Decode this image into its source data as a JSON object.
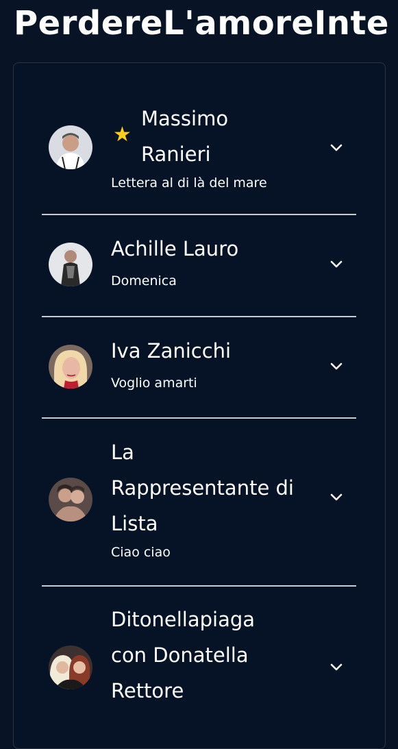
{
  "page": {
    "title": "PerdereL'amoreInte"
  },
  "entries": [
    {
      "starred": true,
      "artist_lines": [
        "Massimo",
        "Ranieri"
      ],
      "song": "Lettera al di là del mare",
      "avatar": "avatar-massimo-ranieri"
    },
    {
      "starred": false,
      "artist_lines": [
        "Achille Lauro"
      ],
      "song": "Domenica",
      "avatar": "avatar-achille-lauro"
    },
    {
      "starred": false,
      "artist_lines": [
        "Iva Zanicchi"
      ],
      "song": "Voglio amarti",
      "avatar": "avatar-iva-zanicchi"
    },
    {
      "starred": false,
      "artist_lines": [
        "La",
        "Rappresentante di",
        "Lista"
      ],
      "song": "Ciao ciao",
      "avatar": "avatar-la-rappresentante-di-lista"
    },
    {
      "starred": false,
      "artist_lines": [
        "Ditonellapiaga",
        "con Donatella",
        "Rettore"
      ],
      "song": "",
      "avatar": "avatar-ditonellapiaga-rettore"
    }
  ],
  "icons": {
    "star": "star-icon",
    "chevron": "chevron-down-icon"
  },
  "colors": {
    "background": "#081426",
    "star": "#ffcc1a",
    "divider": "#c8cdd4"
  }
}
